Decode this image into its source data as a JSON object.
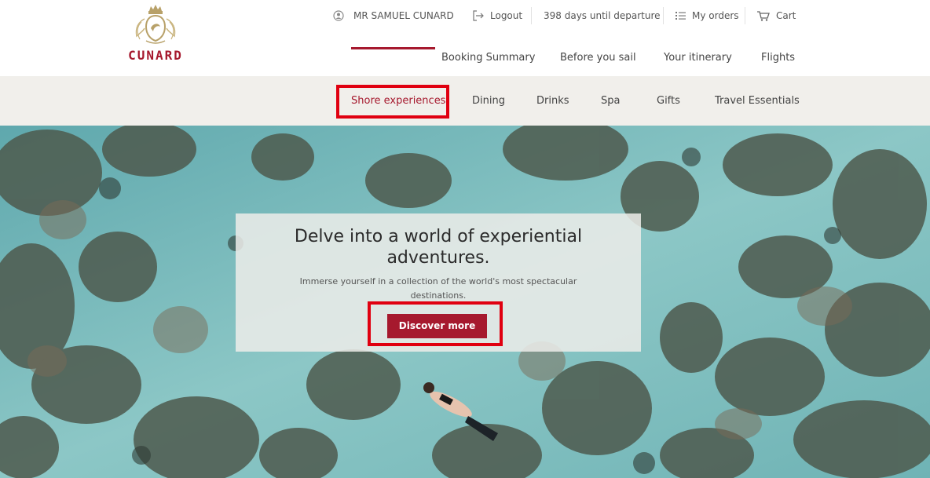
{
  "brand": {
    "name": "CUNARD"
  },
  "topbar": {
    "user_name": "MR SAMUEL CUNARD",
    "logout": "Logout",
    "countdown": "398 days until departure",
    "my_orders": "My orders",
    "cart": "Cart"
  },
  "main_nav": [
    "Booking Summary",
    "Before you sail",
    "Your itinerary",
    "Flights"
  ],
  "sub_nav": {
    "active": "Shore experiences",
    "items": [
      "Shore experiences",
      "Dining",
      "Drinks",
      "Spa",
      "Gifts",
      "Travel Essentials"
    ]
  },
  "hero": {
    "title_line1": "Delve into a world of experiential",
    "title_line2": "adventures.",
    "subtitle_line1": "Immerse yourself in a collection of the world's most spectacular",
    "subtitle_line2": "destinations.",
    "cta": "Discover more"
  },
  "icons": {
    "user": "user-circle-icon",
    "logout": "logout-arrow-icon",
    "orders": "list-icon",
    "cart": "cart-icon"
  },
  "colors": {
    "brand_red": "#a6192e",
    "highlight_red": "#e00010",
    "subnav_bg": "#f1efeb"
  }
}
